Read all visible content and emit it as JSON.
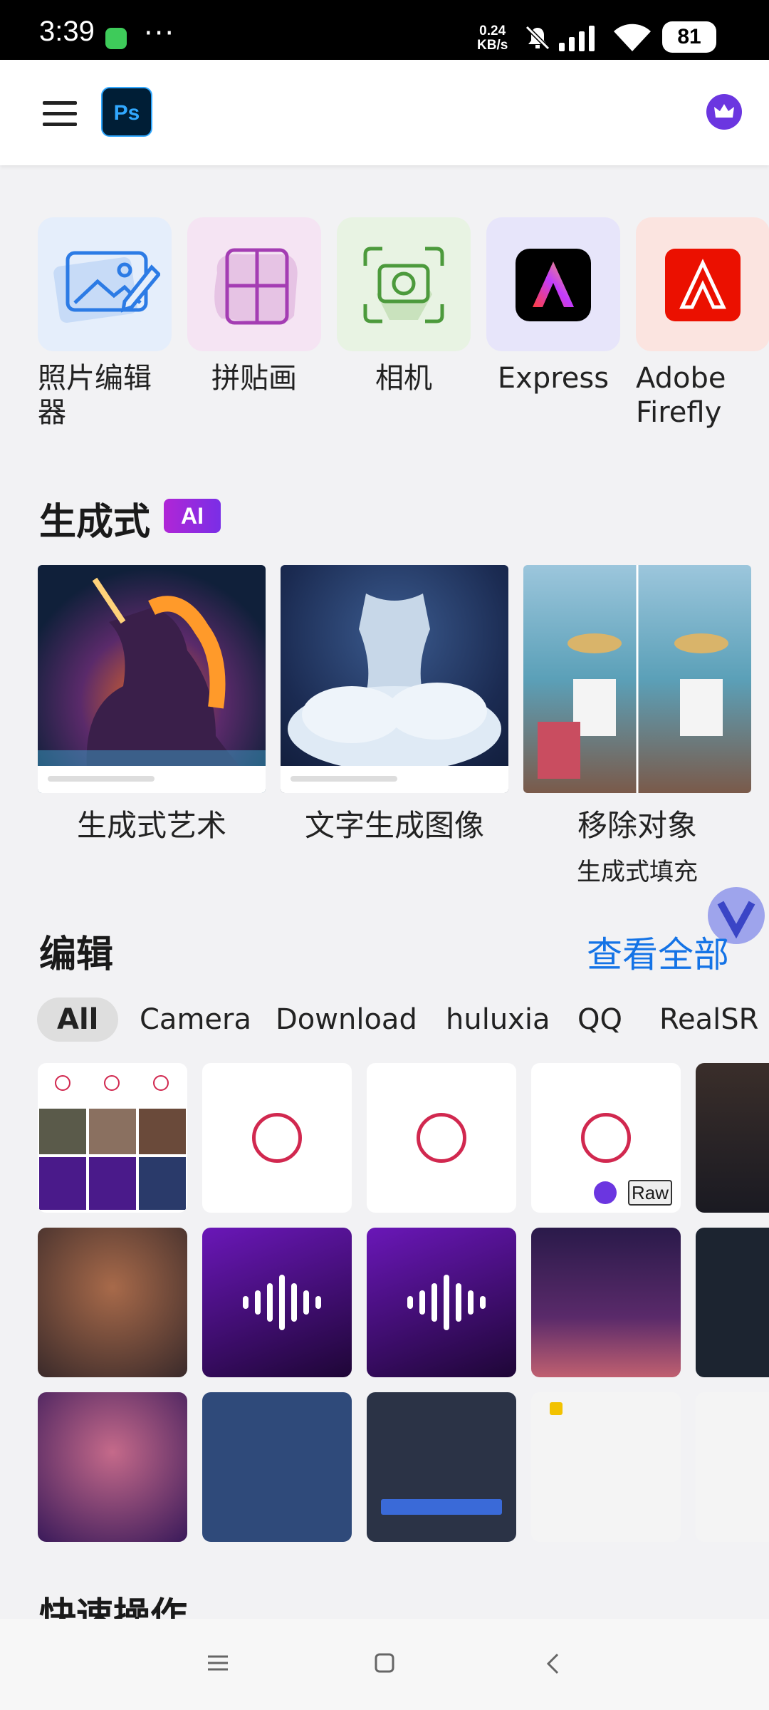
{
  "status_bar": {
    "time": "3:39",
    "more": "···",
    "speed_value": "0.24",
    "speed_unit": "KB/s",
    "battery": "81"
  },
  "header": {
    "logo_text": "Ps"
  },
  "tools": [
    {
      "label": "照片编辑器",
      "color": "#e5eefb"
    },
    {
      "label": "拼贴画",
      "color": "#f5e4f3"
    },
    {
      "label": "相机",
      "color": "#e8f3e3"
    },
    {
      "label": "Express",
      "color": "#e7e5fa"
    },
    {
      "label": "Adobe Firefly",
      "color": "#fbe4e0"
    }
  ],
  "generative": {
    "title": "生成式",
    "badge": "AI",
    "cards": [
      {
        "label": "生成式艺术",
        "sublabel": ""
      },
      {
        "label": "文字生成图像",
        "sublabel": ""
      },
      {
        "label": "移除对象",
        "sublabel": "生成式填充"
      }
    ]
  },
  "edit": {
    "title": "编辑",
    "view_all": "查看全部",
    "tabs": [
      "All",
      "Camera",
      "Download",
      "huluxia",
      "QQ",
      "RealSR"
    ],
    "raw_badge": "Raw"
  },
  "quick_actions": {
    "title": "快速操作"
  },
  "colors": {
    "accent_blue": "#1473e6",
    "ring_red": "#d1284f",
    "premium_purple": "#6b36e0"
  }
}
